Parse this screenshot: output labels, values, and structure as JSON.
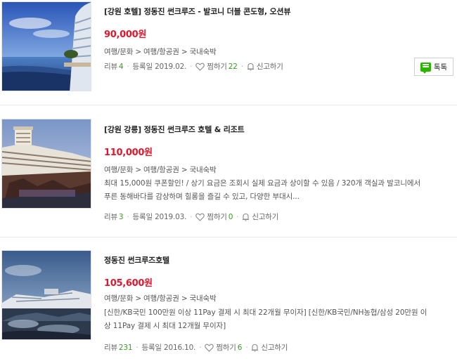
{
  "items": [
    {
      "title": "[강원 호텔] 정동진 썬크루즈 - 발코니 더블 콘도형, 오션뷰",
      "price": "90,000원",
      "category": "여행/문화 > 여행/항공권 > 국내숙박",
      "description": "",
      "review_label": "리뷰",
      "review_count": "4",
      "registered": "등록일 2019.02.",
      "wish_label": "찜하기",
      "wish_count": "22",
      "report_label": "신고하기",
      "talk_label": "톡톡"
    },
    {
      "title": "[강원 강릉] 정동진 썬크루즈 호텔 & 리조트",
      "price": "110,000원",
      "category": "여행/문화 > 여행/항공권 > 국내숙박",
      "description_line1": "최대 15,000원 쿠폰할인! / 상기 요금은 조회시 실제 요금과 상이할 수 있음 / 320개 객실과 발코니에서",
      "description_line2": "푸른 동해바다를 감상하며 힐롱을 즐길 수 있고, 다양한 부대시...",
      "review_label": "리뷰",
      "review_count": "3",
      "registered": "등록일 2019.03.",
      "wish_label": "찜하기",
      "wish_count": "0",
      "report_label": "신고하기"
    },
    {
      "title": "정동진 썬크루즈호텔",
      "price": "105,600원",
      "category": "여행/문화 > 여행/항공권 > 국내숙박",
      "description_line1": "[신한/KB국민 100만원 이상 11Pay 결제 시 최대 22개월 무이자] [신한/KB국민/NH농협/삼성 20만원 이",
      "description_line2": "상 11Pay 결제 시 최대 12개월 무이자]",
      "review_label": "리뷰",
      "review_count": "231",
      "registered": "등록일 2016.10.",
      "wish_label": "찜하기",
      "wish_count": "6",
      "report_label": "신고하기"
    }
  ],
  "colors": {
    "price": "#e2172d",
    "count": "#3a9d23",
    "talk_icon": "#2db400"
  },
  "icons": {
    "wish": "heart-icon",
    "report": "bell-icon",
    "talk": "talk-icon"
  }
}
